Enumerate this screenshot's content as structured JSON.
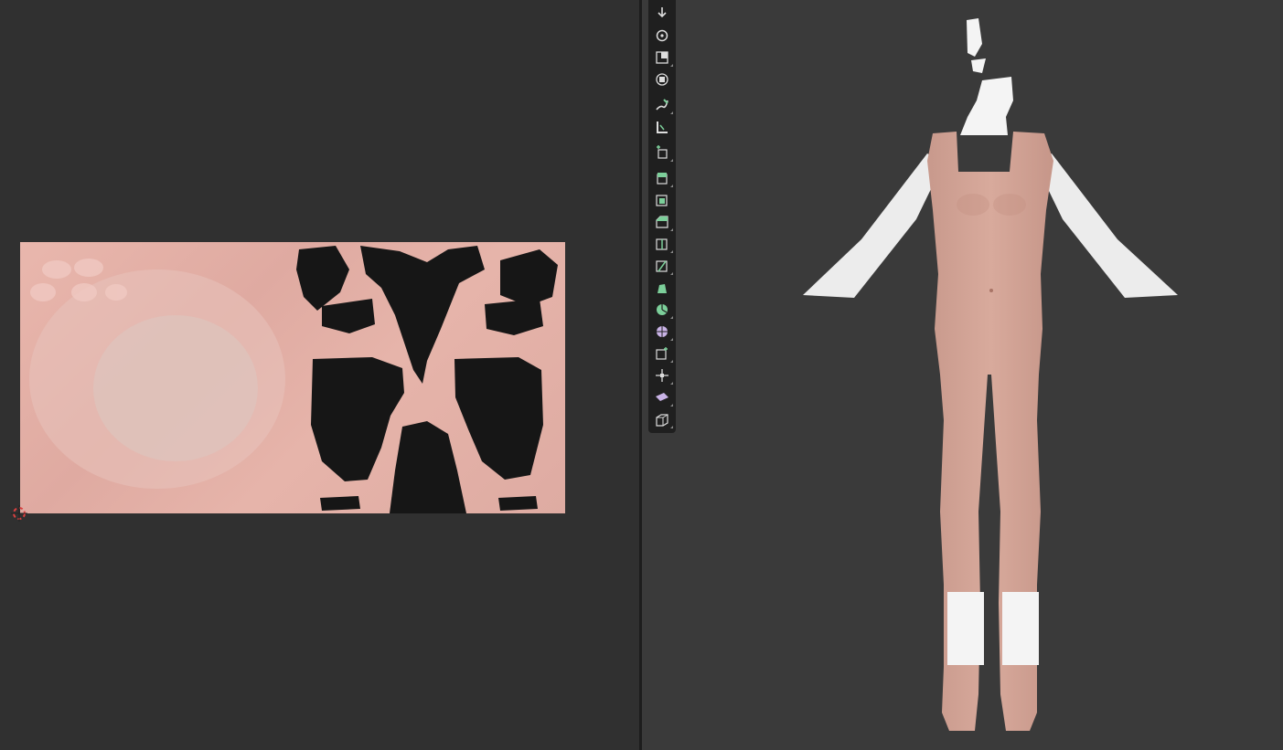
{
  "app": {
    "left_editor": "uv-editor",
    "right_editor": "3d-viewport"
  },
  "colors": {
    "editor_bg": "#303030",
    "viewport_bg": "#3a3a3a",
    "toolbar_bg": "#1f1f1f",
    "skin": "#d7a89a",
    "uv_black": "#161616",
    "tool_green": "#7ccf9a",
    "tool_purple": "#c9b3e6"
  },
  "toolbar": {
    "tools": [
      {
        "name": "cursor-tool",
        "icon": "cursor-icon"
      },
      {
        "name": "rotate-tool",
        "icon": "rotate-icon"
      },
      {
        "name": "scale-tool",
        "icon": "scale-icon"
      },
      {
        "name": "transform-tool",
        "icon": "transform-icon"
      },
      {
        "name": "annotate-tool",
        "icon": "annotate-icon"
      },
      {
        "name": "measure-tool",
        "icon": "measure-icon"
      },
      {
        "name": "add-cube-tool",
        "icon": "add-cube-icon"
      },
      {
        "name": "extrude-region-tool",
        "icon": "extrude-icon"
      },
      {
        "name": "inset-faces-tool",
        "icon": "inset-icon"
      },
      {
        "name": "bevel-tool",
        "icon": "bevel-icon"
      },
      {
        "name": "loop-cut-tool",
        "icon": "loop-cut-icon"
      },
      {
        "name": "knife-tool",
        "icon": "knife-icon"
      },
      {
        "name": "poly-build-tool",
        "icon": "poly-build-icon"
      },
      {
        "name": "spin-tool",
        "icon": "spin-icon"
      },
      {
        "name": "smooth-tool",
        "icon": "smooth-icon"
      },
      {
        "name": "edge-slide-tool",
        "icon": "edge-slide-icon"
      },
      {
        "name": "shrink-fatten-tool",
        "icon": "shrink-fatten-icon"
      },
      {
        "name": "shear-tool",
        "icon": "shear-icon"
      },
      {
        "name": "rip-region-tool",
        "icon": "rip-icon"
      }
    ]
  }
}
